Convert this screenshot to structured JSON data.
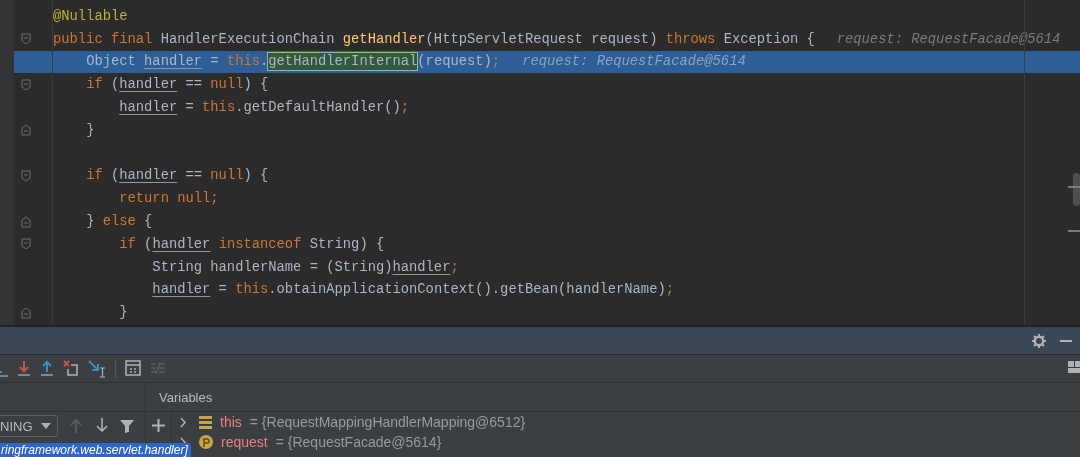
{
  "editor": {
    "lines": [
      {
        "highlighted": false,
        "tokens": [
          {
            "text": "@Nullable",
            "kind": "ann"
          }
        ]
      },
      {
        "highlighted": false,
        "fold_open": true,
        "tokens": [
          {
            "text": "public final ",
            "kind": "kw"
          },
          {
            "text": "HandlerExecutionChain ",
            "kind": "plain"
          },
          {
            "text": "getHandler",
            "kind": "decl"
          },
          {
            "text": "(HttpServletRequest request) ",
            "kind": "plain"
          },
          {
            "text": "throws",
            "kind": "kw"
          },
          {
            "text": " Exception {",
            "kind": "plain"
          }
        ],
        "hint": "request: RequestFacade@5614"
      },
      {
        "highlighted": true,
        "tokens": [
          {
            "text": "    Object ",
            "kind": "plain"
          },
          {
            "text": "handler",
            "kind": "var"
          },
          {
            "text": " = ",
            "kind": "plain"
          },
          {
            "text": "this",
            "kind": "kw"
          },
          {
            "text": ".",
            "kind": "plain"
          },
          {
            "text": "getHandlerInternal",
            "kind": "boxed"
          },
          {
            "text": "(request)",
            "kind": "plain"
          },
          {
            "text": ";",
            "kind": "kw"
          }
        ],
        "hint": "request: RequestFacade@5614"
      },
      {
        "highlighted": false,
        "fold_open": true,
        "tokens": [
          {
            "text": "    if",
            "kind": "kw"
          },
          {
            "text": " (",
            "kind": "plain"
          },
          {
            "text": "handler",
            "kind": "var"
          },
          {
            "text": " == ",
            "kind": "plain"
          },
          {
            "text": "null",
            "kind": "kw"
          },
          {
            "text": ") {",
            "kind": "plain"
          }
        ]
      },
      {
        "highlighted": false,
        "tokens": [
          {
            "text": "        handler",
            "kind": "var"
          },
          {
            "text": " = ",
            "kind": "plain"
          },
          {
            "text": "this",
            "kind": "kw"
          },
          {
            "text": ".getDefaultHandler()",
            "kind": "plain"
          },
          {
            "text": ";",
            "kind": "kw"
          }
        ]
      },
      {
        "highlighted": false,
        "fold_close": true,
        "tokens": [
          {
            "text": "    }",
            "kind": "plain"
          }
        ]
      },
      {
        "highlighted": false
      },
      {
        "highlighted": false,
        "fold_open": true,
        "tokens": [
          {
            "text": "    if",
            "kind": "kw"
          },
          {
            "text": " (",
            "kind": "plain"
          },
          {
            "text": "handler",
            "kind": "var"
          },
          {
            "text": " == ",
            "kind": "plain"
          },
          {
            "text": "null",
            "kind": "kw"
          },
          {
            "text": ") {",
            "kind": "plain"
          }
        ]
      },
      {
        "highlighted": false,
        "tokens": [
          {
            "text": "        return null;",
            "kind": "kw"
          }
        ]
      },
      {
        "highlighted": false,
        "fold_close": true,
        "tokens": [
          {
            "text": "    } ",
            "kind": "plain"
          },
          {
            "text": "else",
            "kind": "kw"
          },
          {
            "text": " {",
            "kind": "plain"
          }
        ]
      },
      {
        "highlighted": false,
        "fold_open": true,
        "tokens": [
          {
            "text": "        if",
            "kind": "kw"
          },
          {
            "text": " (",
            "kind": "plain"
          },
          {
            "text": "handler",
            "kind": "var"
          },
          {
            "text": " instanceof",
            "kind": "kw"
          },
          {
            "text": " String) {",
            "kind": "plain"
          }
        ]
      },
      {
        "highlighted": false,
        "tokens": [
          {
            "text": "            String handlerName = (String)",
            "kind": "plain"
          },
          {
            "text": "handler",
            "kind": "var"
          },
          {
            "text": ";",
            "kind": "kw"
          }
        ]
      },
      {
        "highlighted": false,
        "tokens": [
          {
            "text": "            handler",
            "kind": "var"
          },
          {
            "text": " = ",
            "kind": "plain"
          },
          {
            "text": "this",
            "kind": "kw"
          },
          {
            "text": ".obtainApplicationContext().getBean(handlerName)",
            "kind": "plain"
          },
          {
            "text": ";",
            "kind": "kw"
          }
        ]
      },
      {
        "highlighted": false,
        "fold_close": true,
        "tokens": [
          {
            "text": "        }",
            "kind": "plain"
          }
        ]
      }
    ]
  },
  "debugger": {
    "thread_dropdown": "NING",
    "variables_title": "Variables",
    "variables": [
      {
        "kind": "field",
        "name": "this",
        "value": "= {RequestMappingHandlerMapping@6512}"
      },
      {
        "kind": "param",
        "name": "request",
        "value": "= {RequestFacade@5614}"
      }
    ],
    "tooltip": "ringframework.web.servlet.handler]"
  }
}
